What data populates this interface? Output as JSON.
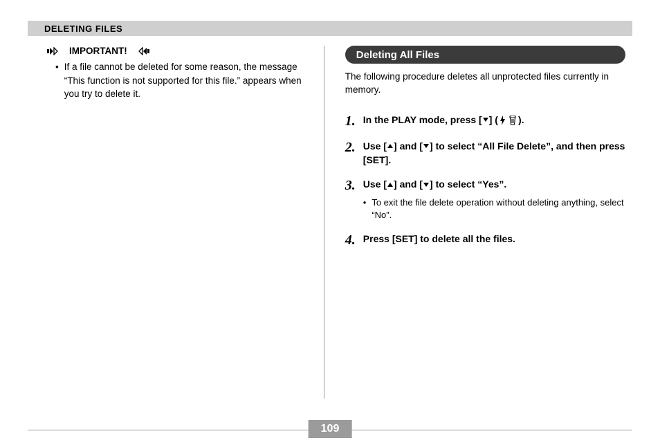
{
  "header": "DELETING FILES",
  "left": {
    "important_label": "IMPORTANT!",
    "bullet": "If a file cannot be deleted for some reason, the message “This function is not supported for this file.” appears when you try to delete it."
  },
  "right": {
    "section_title": "Deleting All Files",
    "intro": "The following procedure deletes all unprotected files currently in memory.",
    "steps": {
      "s1": {
        "num": "1.",
        "pre": "In the PLAY mode, press [",
        "mid": "] (",
        "post": ")."
      },
      "s2": {
        "num": "2.",
        "pre": "Use [",
        "mid1": "] and [",
        "mid2": "] to select “All File Delete”, and then press [SET]."
      },
      "s3": {
        "num": "3.",
        "pre": "Use [",
        "mid1": "] and [",
        "mid2": "] to select “Yes”.",
        "sub": "To exit the file delete operation without deleting anything, select “No”."
      },
      "s4": {
        "num": "4.",
        "text": "Press [SET] to delete all the files."
      }
    }
  },
  "page_number": "109"
}
